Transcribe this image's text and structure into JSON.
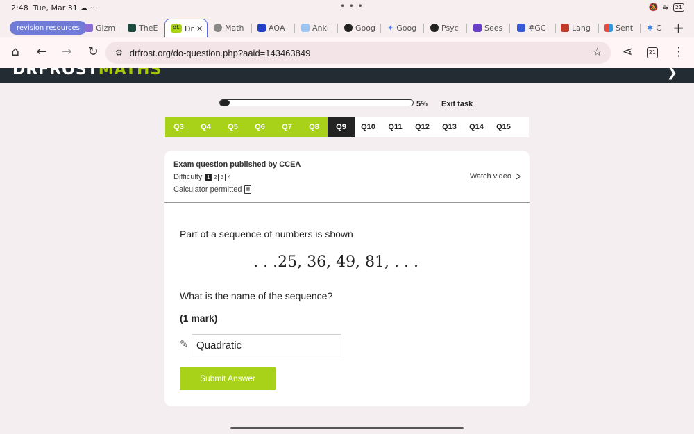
{
  "status": {
    "time": "2:48",
    "date": "Tue, Mar 31",
    "battery": "21",
    "dots": "• • •"
  },
  "tabs": {
    "group_label": "revision resources",
    "items": [
      "Gizm",
      "TheE",
      "Dr",
      "Math",
      "AQA",
      "Anki",
      "Goog",
      "Goog",
      "Psyc",
      "Sees",
      "#GC",
      "Lang",
      "Sent",
      "C"
    ],
    "new_tab": "+",
    "close": "✕"
  },
  "address": {
    "url": "drfrost.org/do-question.php?aaid=143463849",
    "tab_count": "21"
  },
  "site": {
    "logo_main": "DRFROST",
    "logo_accent": "MATHS"
  },
  "progress": {
    "fraction": 0.05,
    "percent_label": "5%",
    "exit_label": "Exit task"
  },
  "questions": {
    "labels": [
      "Q3",
      "Q4",
      "Q5",
      "Q6",
      "Q7",
      "Q8",
      "Q9",
      "Q10",
      "Q11",
      "Q12",
      "Q13",
      "Q14",
      "Q15"
    ],
    "states": [
      "done",
      "done",
      "done",
      "done",
      "done",
      "done",
      "current",
      "todo",
      "todo",
      "todo",
      "todo",
      "todo",
      "todo"
    ]
  },
  "card": {
    "publisher": "Exam question published by CCEA",
    "difficulty_label": "Difficulty",
    "difficulty_levels": [
      "1",
      "2",
      "3",
      "4"
    ],
    "difficulty_value": 1,
    "calculator_label": "Calculator permitted",
    "watch_video": "Watch video",
    "intro": "Part of a sequence of numbers is shown",
    "sequence": ". . .25, 36, 49, 81, . . .",
    "question": "What is the name of the sequence?",
    "marks": "(1 mark)",
    "answer_value": "Quadratic",
    "submit_label": "Submit Answer"
  },
  "colors": {
    "accent": "#a8d21a",
    "dark": "#232323",
    "tab_group": "#6f7bd6"
  }
}
